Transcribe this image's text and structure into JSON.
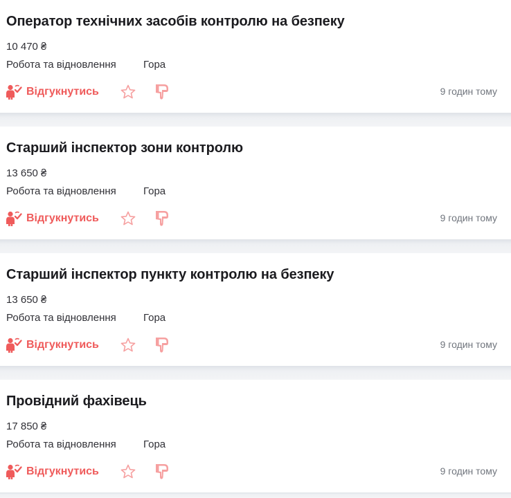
{
  "jobs": [
    {
      "title": "Оператор технічних засобів контролю на безпеку",
      "salary": "10 470 ₴",
      "company": "Робота та відновлення",
      "city": "Гора",
      "apply_label": "Відгукнутись",
      "time": "9 годин тому"
    },
    {
      "title": "Старший інспектор зони контролю",
      "salary": "13 650 ₴",
      "company": "Робота та відновлення",
      "city": "Гора",
      "apply_label": "Відгукнутись",
      "time": "9 годин тому"
    },
    {
      "title": "Старший інспектор пункту контролю на безпеку",
      "salary": "13 650 ₴",
      "company": "Робота та відновлення",
      "city": "Гора",
      "apply_label": "Відгукнутись",
      "time": "9 годин тому"
    },
    {
      "title": "Провідний фахівець",
      "salary": "17 850 ₴",
      "company": "Робота та відновлення",
      "city": "Гора",
      "apply_label": "Відгукнутись",
      "time": "9 годин тому"
    }
  ],
  "icons": {
    "apply": "person-check-icon",
    "favorite": "star-icon",
    "dislike": "thumbs-down-icon"
  },
  "colors": {
    "accent": "#ef5b5b",
    "accent_light": "#f6a0a0",
    "title": "#1b1b1f",
    "text": "#303036",
    "muted": "#70757d",
    "background": "#eceef1",
    "card": "#ffffff"
  }
}
